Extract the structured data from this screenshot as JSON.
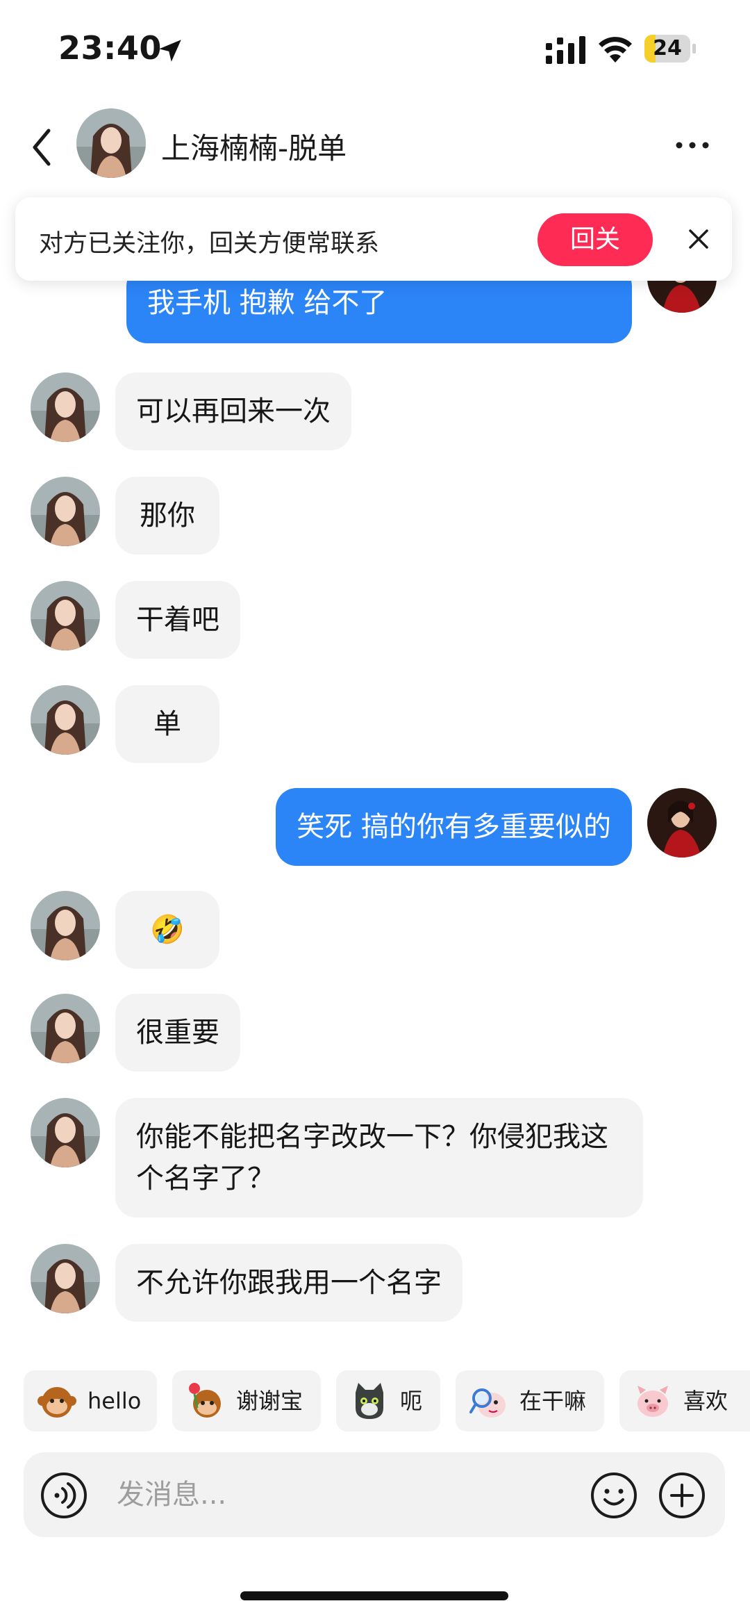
{
  "status_bar": {
    "time": "23:40",
    "battery_level": "24",
    "battery_fraction": 0.24,
    "icons": [
      "location-arrow-icon",
      "cellular-signal-icon",
      "wifi-icon",
      "battery-icon"
    ]
  },
  "header": {
    "title": "上海楠楠-脱单",
    "icons": [
      "back-chevron-icon",
      "more-dots-icon"
    ]
  },
  "follow_banner": {
    "text": "对方已关注你，回关方便常联系",
    "button_label": "回关",
    "close_icon": "close-icon"
  },
  "messages": [
    {
      "from": "me",
      "text": "我手机 抱歉 给不了"
    },
    {
      "from": "them",
      "text": "可以再回来一次"
    },
    {
      "from": "them",
      "text": "那你"
    },
    {
      "from": "them",
      "text": "干着吧"
    },
    {
      "from": "them",
      "text": "单"
    },
    {
      "from": "me",
      "text": "笑死 搞的你有多重要似的"
    },
    {
      "from": "them",
      "text": "🤣"
    },
    {
      "from": "them",
      "text": "很重要"
    },
    {
      "from": "them",
      "text": "你能不能把名字改改一下？你侵犯我这个名字了？"
    },
    {
      "from": "them",
      "text": "不允许你跟我用一个名字"
    }
  ],
  "quick_replies": [
    {
      "label": "hello",
      "icon": "monkey-sticker-icon"
    },
    {
      "label": "谢谢宝",
      "icon": "monkey-rose-sticker-icon"
    },
    {
      "label": "呃",
      "icon": "cat-sticker-icon"
    },
    {
      "label": "在干嘛",
      "icon": "magnifier-sticker-icon"
    },
    {
      "label": "喜欢",
      "icon": "pig-sticker-icon"
    }
  ],
  "input": {
    "placeholder": "发消息...",
    "icons": [
      "voice-icon",
      "emoji-icon",
      "plus-icon"
    ]
  },
  "colors": {
    "accent_red": "#fe2c55",
    "outgoing_bubble": "#2b85f7",
    "incoming_bubble": "#f3f3f3",
    "battery_yellow": "#f6cf2a"
  }
}
